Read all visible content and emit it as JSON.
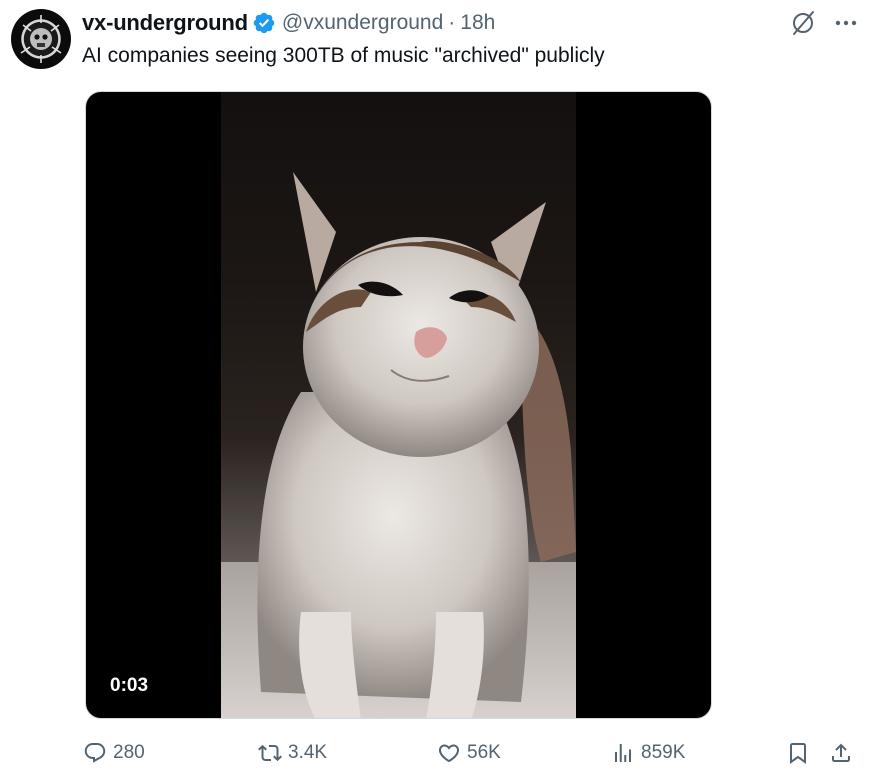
{
  "tweet": {
    "display_name": "vx-underground",
    "handle": "@vxunderground",
    "separator": "·",
    "time": "18h",
    "text": "AI companies seeing 300TB of music \"archived\" publicly"
  },
  "media": {
    "type": "video",
    "duration": "0:03"
  },
  "actions": {
    "replies": "280",
    "reposts": "3.4K",
    "likes": "56K",
    "views": "859K"
  },
  "icons": {
    "verified": "verified-badge-icon",
    "grok": "grok-icon",
    "more": "more-icon",
    "reply": "reply-icon",
    "repost": "repost-icon",
    "like": "heart-icon",
    "views": "views-icon",
    "bookmark": "bookmark-icon",
    "share": "share-icon"
  },
  "colors": {
    "text": "#0f1419",
    "muted": "#536471",
    "verified": "#1d9bf0"
  }
}
